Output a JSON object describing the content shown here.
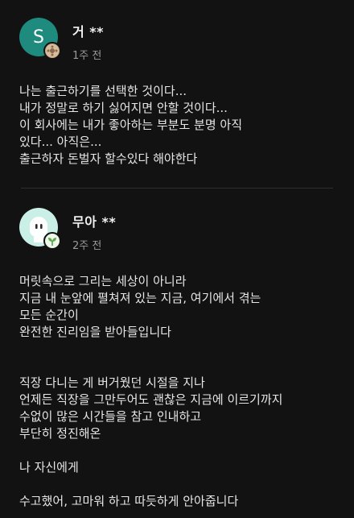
{
  "comments": [
    {
      "avatar_letter": "S",
      "avatar_color": "#1f8a7e",
      "name": "거 **",
      "time": "1주 전",
      "text": "나는 출근하기를 선택한 것이다...\n내가 정말로 하기 싫어지면 안할 것이다...\n이 회사에는 내가 좋아하는 부분도 분명 아직\n있다... 아직은...\n출근하자 돈벌자 할수있다 해야한다"
    },
    {
      "avatar_color": "#c9efe6",
      "name": "무아 **",
      "time": "2주 전",
      "text": "머릿속으로 그리는 세상이 아니라\n지금 내 눈앞에 펼쳐져 있는 지금, 여기에서 겪는\n모든 순간이\n완전한 진리임을 받아들입니다\n\n\n직장 다니는 게 버거웠던 시절을 지나\n언제든 직장을 그만두어도 괜찮은 지금에 이르기까지\n수없이 많은 시간들을 참고 인내하고\n부단히 정진해온\n\n나 자신에게\n\n수고했어, 고마워 하고 따듯하게 안아줍니다\n\n지금, 여기"
    }
  ]
}
